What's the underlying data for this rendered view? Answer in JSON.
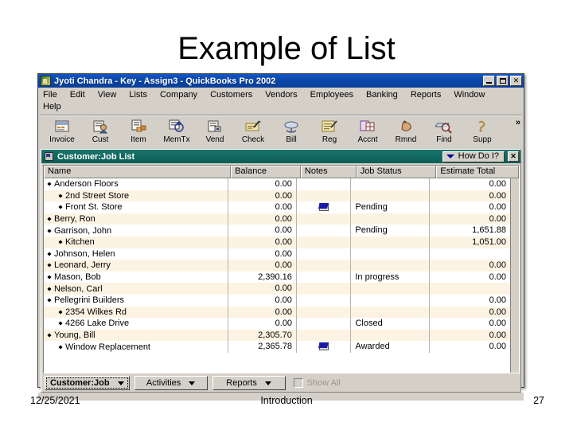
{
  "slide": {
    "title": "Example of List"
  },
  "app": {
    "title": "Jyoti Chandra - Key - Assign3 - QuickBooks Pro 2002",
    "title_icon": "quickbooks-icon",
    "window_buttons": [
      {
        "name": "minimize",
        "glyph": ""
      },
      {
        "name": "maximize",
        "glyph": ""
      },
      {
        "name": "close",
        "glyph": "✕"
      }
    ],
    "menus": [
      "File",
      "Edit",
      "View",
      "Lists",
      "Company",
      "Customers",
      "Vendors",
      "Employees",
      "Banking",
      "Reports",
      "Window",
      "Help"
    ],
    "toolbar": [
      {
        "label": "Invoice",
        "icon": "invoice-icon"
      },
      {
        "label": "Cust",
        "icon": "customer-icon"
      },
      {
        "label": "Item",
        "icon": "item-icon"
      },
      {
        "label": "MemTx",
        "icon": "memorized-transaction-icon"
      },
      {
        "label": "Vend",
        "icon": "vendor-icon"
      },
      {
        "label": "Check",
        "icon": "check-icon"
      },
      {
        "label": "Bill",
        "icon": "bill-icon"
      },
      {
        "label": "Reg",
        "icon": "register-icon"
      },
      {
        "label": "Accnt",
        "icon": "account-icon"
      },
      {
        "label": "Rmnd",
        "icon": "reminder-icon"
      },
      {
        "label": "Find",
        "icon": "find-icon"
      },
      {
        "label": "Supp",
        "icon": "support-icon"
      }
    ],
    "toolbar_overflow": "»"
  },
  "list_window": {
    "title": "Customer:Job List",
    "help_button": "How Do I?",
    "close_glyph": "✕",
    "columns": [
      "Name",
      "Balance",
      "Notes",
      "Job Status",
      "Estimate Total"
    ],
    "rows": [
      {
        "name": "Anderson Floors",
        "level": 0,
        "balance": "0.00",
        "note": false,
        "status": "",
        "estimate": "0.00"
      },
      {
        "name": "2nd Street Store",
        "level": 1,
        "balance": "0.00",
        "note": false,
        "status": "",
        "estimate": "0.00"
      },
      {
        "name": "Front St. Store",
        "level": 1,
        "balance": "0.00",
        "note": true,
        "status": "Pending",
        "estimate": "0.00"
      },
      {
        "name": "Berry, Ron",
        "level": 0,
        "balance": "0.00",
        "note": false,
        "status": "",
        "estimate": "0.00"
      },
      {
        "name": "Garrison, John",
        "level": 0,
        "balance": "0.00",
        "note": false,
        "status": "Pending",
        "estimate": "1,651.88"
      },
      {
        "name": "Kitchen",
        "level": 1,
        "balance": "0.00",
        "note": false,
        "status": "",
        "estimate": "1,051.00"
      },
      {
        "name": "Johnson, Helen",
        "level": 0,
        "balance": "0.00",
        "note": false,
        "status": "",
        "estimate": ""
      },
      {
        "name": "Leonard, Jerry",
        "level": 0,
        "balance": "0.00",
        "note": false,
        "status": "",
        "estimate": "0.00"
      },
      {
        "name": "Mason, Bob",
        "level": 0,
        "balance": "2,390.16",
        "note": false,
        "status": "In progress",
        "estimate": "0.00"
      },
      {
        "name": "Nelson, Carl",
        "level": 0,
        "balance": "0.00",
        "note": false,
        "status": "",
        "estimate": ""
      },
      {
        "name": "Pellegrini Builders",
        "level": 0,
        "balance": "0.00",
        "note": false,
        "status": "",
        "estimate": "0.00"
      },
      {
        "name": "2354 Wilkes Rd",
        "level": 1,
        "balance": "0.00",
        "note": false,
        "status": "",
        "estimate": "0.00"
      },
      {
        "name": "4266 Lake Drive",
        "level": 1,
        "balance": "0.00",
        "note": false,
        "status": "Closed",
        "estimate": "0.00"
      },
      {
        "name": "Young, Bill",
        "level": 0,
        "balance": "2,305.70",
        "note": false,
        "status": "",
        "estimate": "0.00"
      },
      {
        "name": "Window Replacement",
        "level": 1,
        "balance": "2,365.78",
        "note": true,
        "status": "Awarded",
        "estimate": "0.00"
      }
    ],
    "buttons": [
      {
        "label": "Customer:Job",
        "dropdown": true,
        "focused": true
      },
      {
        "label": "Activities",
        "dropdown": true,
        "focused": false
      },
      {
        "label": "Reports",
        "dropdown": true,
        "focused": false
      }
    ],
    "show_all": {
      "label": "Show All",
      "checked": false,
      "enabled": false
    }
  },
  "footer": {
    "date": "12/25/2021",
    "center": "Introduction",
    "page": "27"
  },
  "colors": {
    "app_title_bar": "#0b47a8",
    "mdi_title_bar": "#0e6b63",
    "chrome": "#d4d0c8",
    "row_alt": "#fdf3e3",
    "note_icon": "#1a1aa8"
  }
}
